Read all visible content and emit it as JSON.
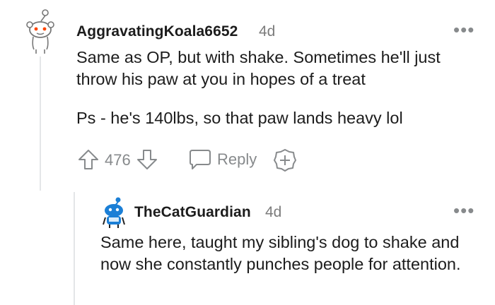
{
  "comments": [
    {
      "username": "AggravatingKoala6652",
      "age": "4d",
      "paragraphs": [
        "Same as OP, but with shake. Sometimes he'll just throw his paw at you in hopes of a treat",
        "Ps - he's 140lbs, so that paw lands heavy lol"
      ],
      "votes": "476",
      "reply_label": "Reply",
      "avatar_icon": "snoo-avatar-icon",
      "more_icon": "more-options-icon"
    },
    {
      "username": "TheCatGuardian",
      "age": "4d",
      "paragraphs": [
        "Same here, taught my sibling's dog to shake and now she constantly punches people for attention."
      ],
      "avatar_icon": "blue-snoo-avatar-icon",
      "more_icon": "more-options-icon"
    }
  ],
  "colors": {
    "text": "#1c1c1c",
    "meta": "#7c7c7c",
    "icon_gray": "#878a8c",
    "thread_line": "#e4e6e8",
    "avatar_blue": "#1b7fd6",
    "snoo_eye": "#ff4500"
  }
}
